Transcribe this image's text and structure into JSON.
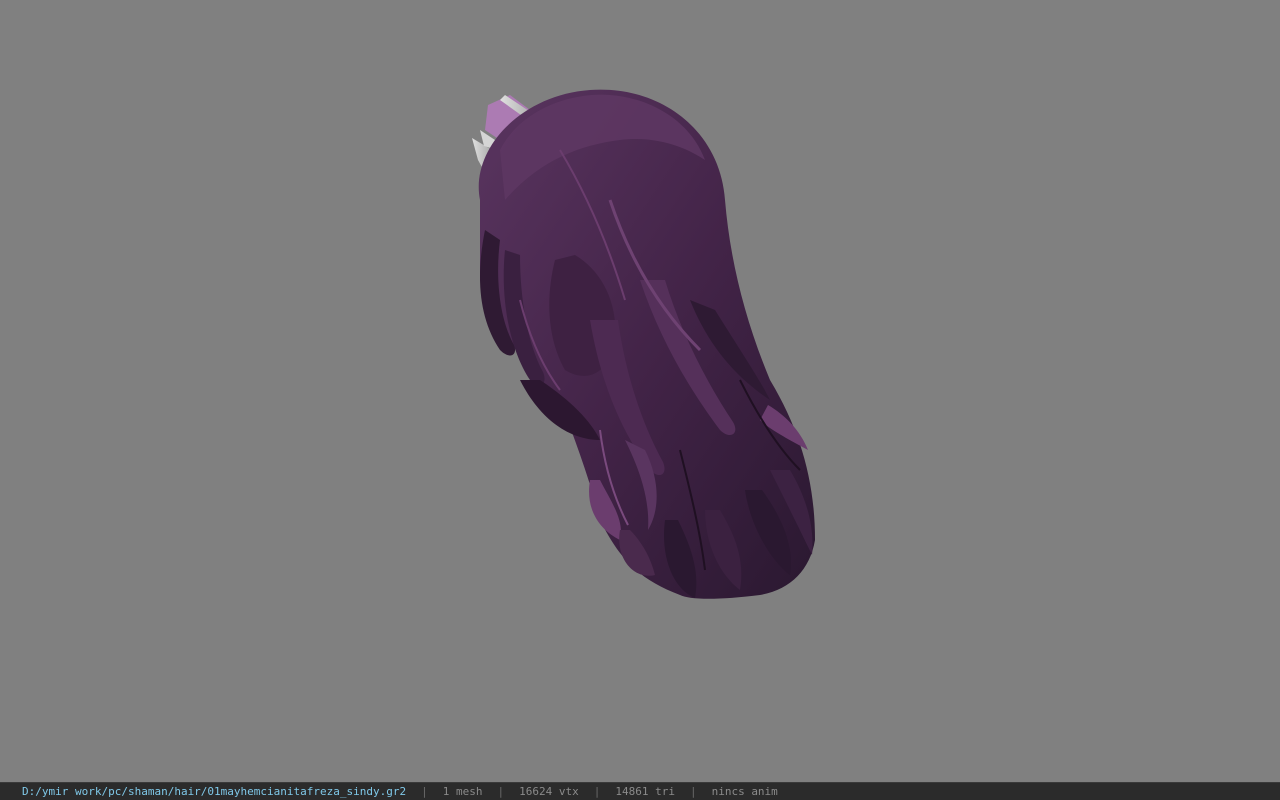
{
  "viewer": {
    "background_color": "#808080",
    "model": {
      "name": "hair-model",
      "primary_color": "#4a2a4d",
      "highlight_color": "#6b3d6e",
      "shadow_color": "#2a1830",
      "accessory_color": "#c8c8c8",
      "accessory_tint": "#b07ab8"
    }
  },
  "statusbar": {
    "path": "D:/ymir work/pc/shaman/hair/01mayhemcianitafreza_sindy.gr2",
    "mesh": "1 mesh",
    "vtx": "16624 vtx",
    "tri": "14861 tri",
    "anim": "nincs anim",
    "separator": "|"
  }
}
